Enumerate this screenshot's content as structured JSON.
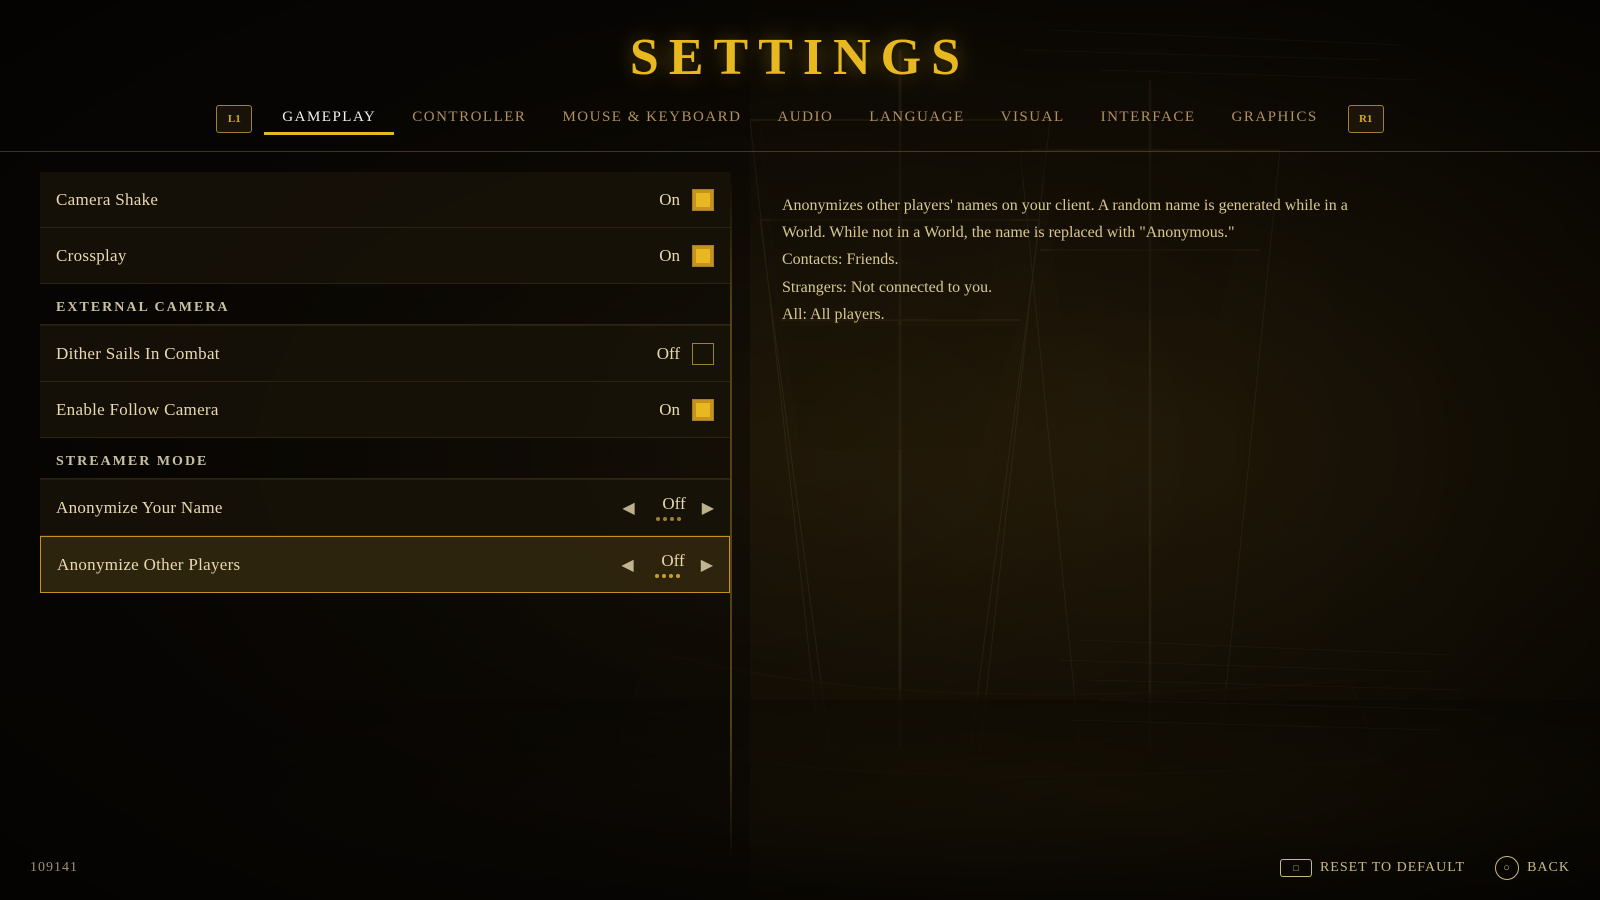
{
  "page": {
    "title": "SETTINGS",
    "version_code": "109141"
  },
  "tabs": [
    {
      "id": "gameplay",
      "label": "GAMEPLAY",
      "active": true
    },
    {
      "id": "controller",
      "label": "CONTROLLER",
      "active": false
    },
    {
      "id": "mouse-keyboard",
      "label": "MOUSE & KEYBOARD",
      "active": false
    },
    {
      "id": "audio",
      "label": "AUDIO",
      "active": false
    },
    {
      "id": "language",
      "label": "LANGUAGE",
      "active": false
    },
    {
      "id": "visual",
      "label": "VISUAL",
      "active": false
    },
    {
      "id": "interface",
      "label": "INTERFACE",
      "active": false
    },
    {
      "id": "graphics",
      "label": "GRAPHICS",
      "active": false
    }
  ],
  "nav_left_button": "L1",
  "nav_right_button": "R1",
  "settings": {
    "sections": [
      {
        "id": "general",
        "items": [
          {
            "id": "camera-shake",
            "label": "Camera Shake",
            "value": "On",
            "control_type": "checkbox",
            "checked": true
          },
          {
            "id": "crossplay",
            "label": "Crossplay",
            "value": "On",
            "control_type": "checkbox",
            "checked": true
          }
        ]
      },
      {
        "id": "external-camera",
        "header": "EXTERNAL CAMERA",
        "items": [
          {
            "id": "dither-sails",
            "label": "Dither Sails In Combat",
            "value": "Off",
            "control_type": "checkbox",
            "checked": false
          },
          {
            "id": "follow-camera",
            "label": "Enable Follow Camera",
            "value": "On",
            "control_type": "checkbox",
            "checked": true
          }
        ]
      },
      {
        "id": "streamer-mode",
        "header": "STREAMER MODE",
        "items": [
          {
            "id": "anonymize-name",
            "label": "Anonymize Your Name",
            "value": "Off",
            "control_type": "arrow",
            "selected": false
          },
          {
            "id": "anonymize-players",
            "label": "Anonymize Other Players",
            "value": "Off",
            "control_type": "arrow",
            "selected": true
          }
        ]
      }
    ]
  },
  "info_panel": {
    "text": "Anonymizes other players' names on your client. A random name is generated while in a World. While not in a World, the name is replaced with \"Anonymous.\"\nContacts: Friends.\nStrangers: Not connected to you.\nAll: All players."
  },
  "bottom_bar": {
    "version_code": "109141",
    "reset_label": "RESET TO DEFAULT",
    "back_label": "BACK",
    "reset_icon": "rectangle",
    "back_icon": "circle"
  }
}
